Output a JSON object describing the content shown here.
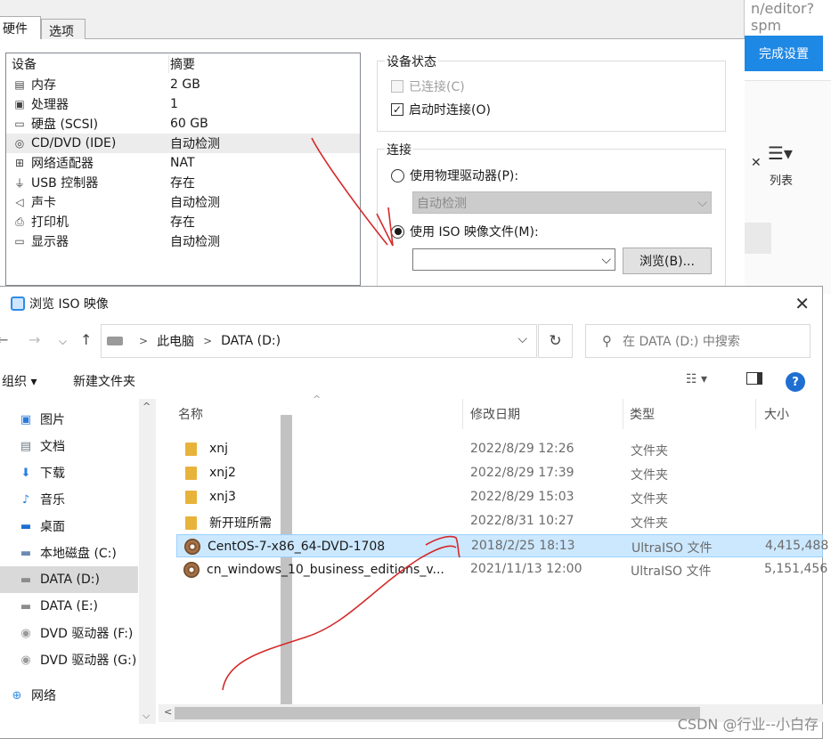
{
  "background": {
    "url_fragment": "n/editor?spm",
    "done_button": "完成设置",
    "list_label": "列表"
  },
  "vm_settings": {
    "tabs": [
      "硬件",
      "选项"
    ],
    "device_list": {
      "headers": [
        "设备",
        "摘要"
      ],
      "rows": [
        {
          "icon": "memory-icon",
          "device": "内存",
          "summary": "2 GB"
        },
        {
          "icon": "cpu-icon",
          "device": "处理器",
          "summary": "1"
        },
        {
          "icon": "disk-icon",
          "device": "硬盘 (SCSI)",
          "summary": "60 GB"
        },
        {
          "icon": "cd-icon",
          "device": "CD/DVD (IDE)",
          "summary": "自动检测",
          "selected": true
        },
        {
          "icon": "network-icon",
          "device": "网络适配器",
          "summary": "NAT"
        },
        {
          "icon": "usb-icon",
          "device": "USB 控制器",
          "summary": "存在"
        },
        {
          "icon": "speaker-icon",
          "device": "声卡",
          "summary": "自动检测"
        },
        {
          "icon": "printer-icon",
          "device": "打印机",
          "summary": "存在"
        },
        {
          "icon": "monitor-icon",
          "device": "显示器",
          "summary": "自动检测"
        }
      ]
    },
    "device_status": {
      "title": "设备状态",
      "connected": {
        "label": "已连接(C)",
        "checked": false,
        "disabled": true
      },
      "connect_at_power_on": {
        "label": "启动时连接(O)",
        "checked": true
      }
    },
    "connection": {
      "title": "连接",
      "physical": {
        "label": "使用物理驱动器(P):",
        "selected": false,
        "value": "自动检测"
      },
      "iso": {
        "label": "使用 ISO 映像文件(M):",
        "selected": true,
        "value": ""
      },
      "browse_button": "浏览(B)..."
    }
  },
  "file_dialog": {
    "title": "浏览 ISO 映像",
    "breadcrumb": [
      "此电脑",
      "DATA (D:)"
    ],
    "search_placeholder": "在 DATA (D:) 中搜索",
    "toolbar": {
      "organize": "组织 ▾",
      "new_folder": "新建文件夹"
    },
    "sidebar": [
      {
        "icon": "pictures-icon",
        "label": "图片"
      },
      {
        "icon": "documents-icon",
        "label": "文档"
      },
      {
        "icon": "download-icon",
        "label": "下载"
      },
      {
        "icon": "music-icon",
        "label": "音乐"
      },
      {
        "icon": "desktop-icon",
        "label": "桌面"
      },
      {
        "icon": "local-disk-icon",
        "label": "本地磁盘 (C:)"
      },
      {
        "icon": "drive-icon",
        "label": "DATA (D:)",
        "selected": true
      },
      {
        "icon": "drive-icon",
        "label": "DATA (E:)"
      },
      {
        "icon": "dvd-drive-icon",
        "label": "DVD 驱动器 (F:)"
      },
      {
        "icon": "dvd-drive-icon",
        "label": "DVD 驱动器 (G:)"
      },
      {
        "icon": "network-icon",
        "label": "网络"
      }
    ],
    "columns": [
      "名称",
      "修改日期",
      "类型",
      "大小"
    ],
    "files": [
      {
        "kind": "folder",
        "name": "xnj",
        "date": "2022/8/29 12:26",
        "type": "文件夹",
        "size": ""
      },
      {
        "kind": "folder",
        "name": "xnj2",
        "date": "2022/8/29 17:39",
        "type": "文件夹",
        "size": ""
      },
      {
        "kind": "folder",
        "name": "xnj3",
        "date": "2022/8/29 15:03",
        "type": "文件夹",
        "size": ""
      },
      {
        "kind": "folder",
        "name": "新开班所需",
        "date": "2022/8/31 10:27",
        "type": "文件夹",
        "size": ""
      },
      {
        "kind": "iso",
        "name": "CentOS-7-x86_64-DVD-1708",
        "date": "2018/2/25 18:13",
        "type": "UltraISO 文件",
        "size": "4,415,488",
        "selected": true
      },
      {
        "kind": "iso",
        "name": "cn_windows_10_business_editions_v...",
        "date": "2021/11/13 12:00",
        "type": "UltraISO 文件",
        "size": "5,151,456"
      }
    ]
  },
  "watermark": "CSDN @行业--小白存",
  "colors": {
    "accent": "#1e88e5",
    "selection": "#cce8ff",
    "annotation": "#d42a2a"
  }
}
